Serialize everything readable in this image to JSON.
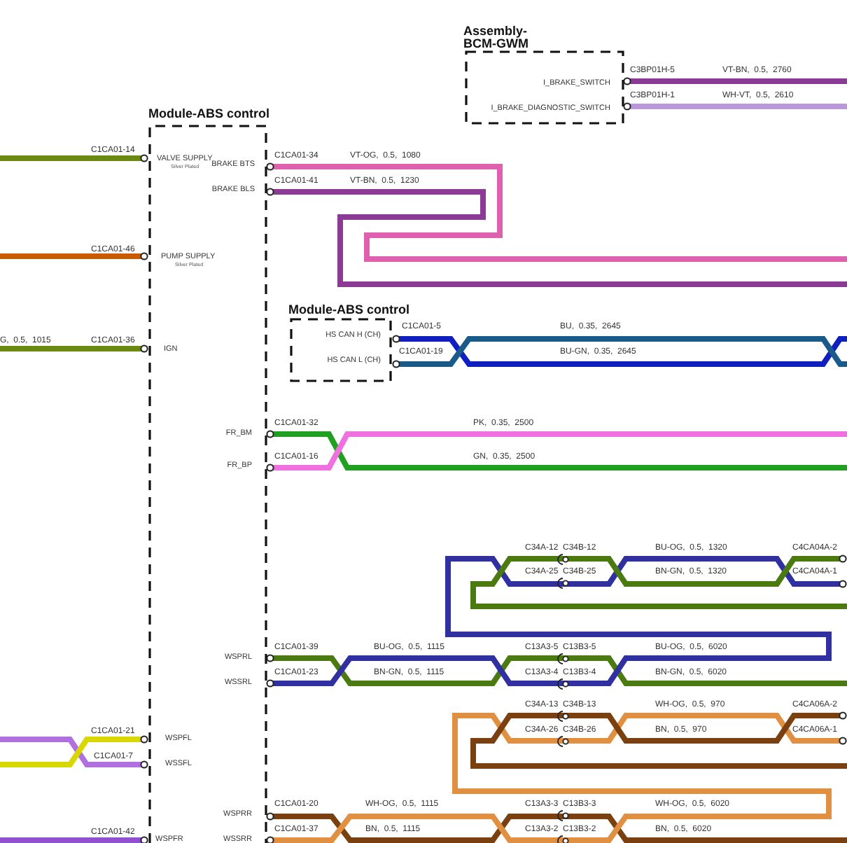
{
  "modules": [
    {
      "title": [
        "Assembly-",
        "BCM-GWM"
      ],
      "pins": [
        {
          "label": "I_BRAKE_SWITCH"
        },
        {
          "label": "I_BRAKE_DIAGNOSTIC_SWITCH"
        }
      ]
    },
    {
      "title": [
        "Module-ABS control"
      ],
      "pins": [
        {
          "label": "VALVE SUPPLY",
          "note": "Silver Plated"
        },
        {
          "label": "BRAKE BTS"
        },
        {
          "label": "BRAKE BLS"
        },
        {
          "label": "PUMP SUPPLY",
          "note": "Silver Plated"
        },
        {
          "label": "IGN"
        },
        {
          "label": "FR_BM"
        },
        {
          "label": "FR_BP"
        },
        {
          "label": "WSPRL"
        },
        {
          "label": "WSSRL"
        },
        {
          "label": "WSPFL"
        },
        {
          "label": "WSSFL"
        },
        {
          "label": "WSPRR"
        },
        {
          "label": "WSSRR"
        },
        {
          "label": "WSPFR"
        }
      ]
    },
    {
      "title": [
        "Module-ABS control"
      ],
      "pins": [
        {
          "label": "HS CAN H (CH)"
        },
        {
          "label": "HS CAN L (CH)"
        }
      ]
    }
  ],
  "connector_labels": [
    "C3BP01H-5",
    "C3BP01H-1",
    "C1CA01-14",
    "C1CA01-34",
    "C1CA01-41",
    "C1CA01-46",
    "C1CA01-5",
    "C1CA01-19",
    "C1CA01-36",
    "C1CA01-32",
    "C1CA01-16",
    "C4CA04A-2",
    "C4CA04A-1",
    "C1CA01-39",
    "C1CA01-23",
    "C4CA06A-2",
    "C4CA06A-1",
    "C1CA01-21",
    "C1CA01-7",
    "C1CA01-20",
    "C1CA01-37",
    "C1CA01-42"
  ],
  "wire_labels": [
    "VT-BN,  0.5,  2760",
    "WH-VT,  0.5,  2610",
    "VT-OG,  0.5,  1080",
    "VT-BN,  0.5,  1230",
    "BU,  0.35,  2645",
    "BU-GN,  0.35,  2645",
    "G,  0.5,  1015",
    "PK,  0.35,  2500",
    "GN,  0.35,  2500",
    "BU-OG,  0.5,  1320",
    "BN-GN,  0.5,  1320",
    "BU-OG,  0.5,  1115",
    "BU-OG,  0.5,  6020",
    "BN-GN,  0.5,  1115",
    "BN-GN,  0.5,  6020",
    "WH-OG,  0.5,  970",
    "BN,  0.5,  970",
    "WH-OG,  0.5,  1115",
    "WH-OG,  0.5,  6020",
    "BN,  0.5,  1115",
    "BN,  0.5,  6020"
  ],
  "splice_labels": [
    "C34A-12  C34B-12",
    "C34A-25  C34B-25",
    "C13A3-5  C13B3-5",
    "C13A3-4  C13B3-4",
    "C34A-13  C34B-13",
    "C34A-26  C34B-26",
    "C13A3-3  C13B3-3",
    "C13A3-2  C13B3-2"
  ],
  "wires": [
    {
      "color": "#8b3a96"
    },
    {
      "color": "#b898d8"
    },
    {
      "color": "#6a8a10"
    },
    {
      "color": "#c85a00"
    },
    {
      "color": "#6a8a10"
    },
    {
      "color": "#e060b0"
    },
    {
      "color": "#8b3a96"
    },
    {
      "color": "#1020c0"
    },
    {
      "color": "#1a5a8a"
    },
    {
      "color": "#20a020"
    },
    {
      "color": "#f070e0"
    },
    {
      "color": "#4a7a10"
    },
    {
      "color": "#3030a0"
    },
    {
      "color": "#4a7a10"
    },
    {
      "color": "#7a4010"
    },
    {
      "color": "#e09040"
    },
    {
      "color": "#7a4010"
    },
    {
      "color": "#b070e0"
    },
    {
      "color": "#d8d800"
    },
    {
      "color": "#9050d0"
    }
  ]
}
